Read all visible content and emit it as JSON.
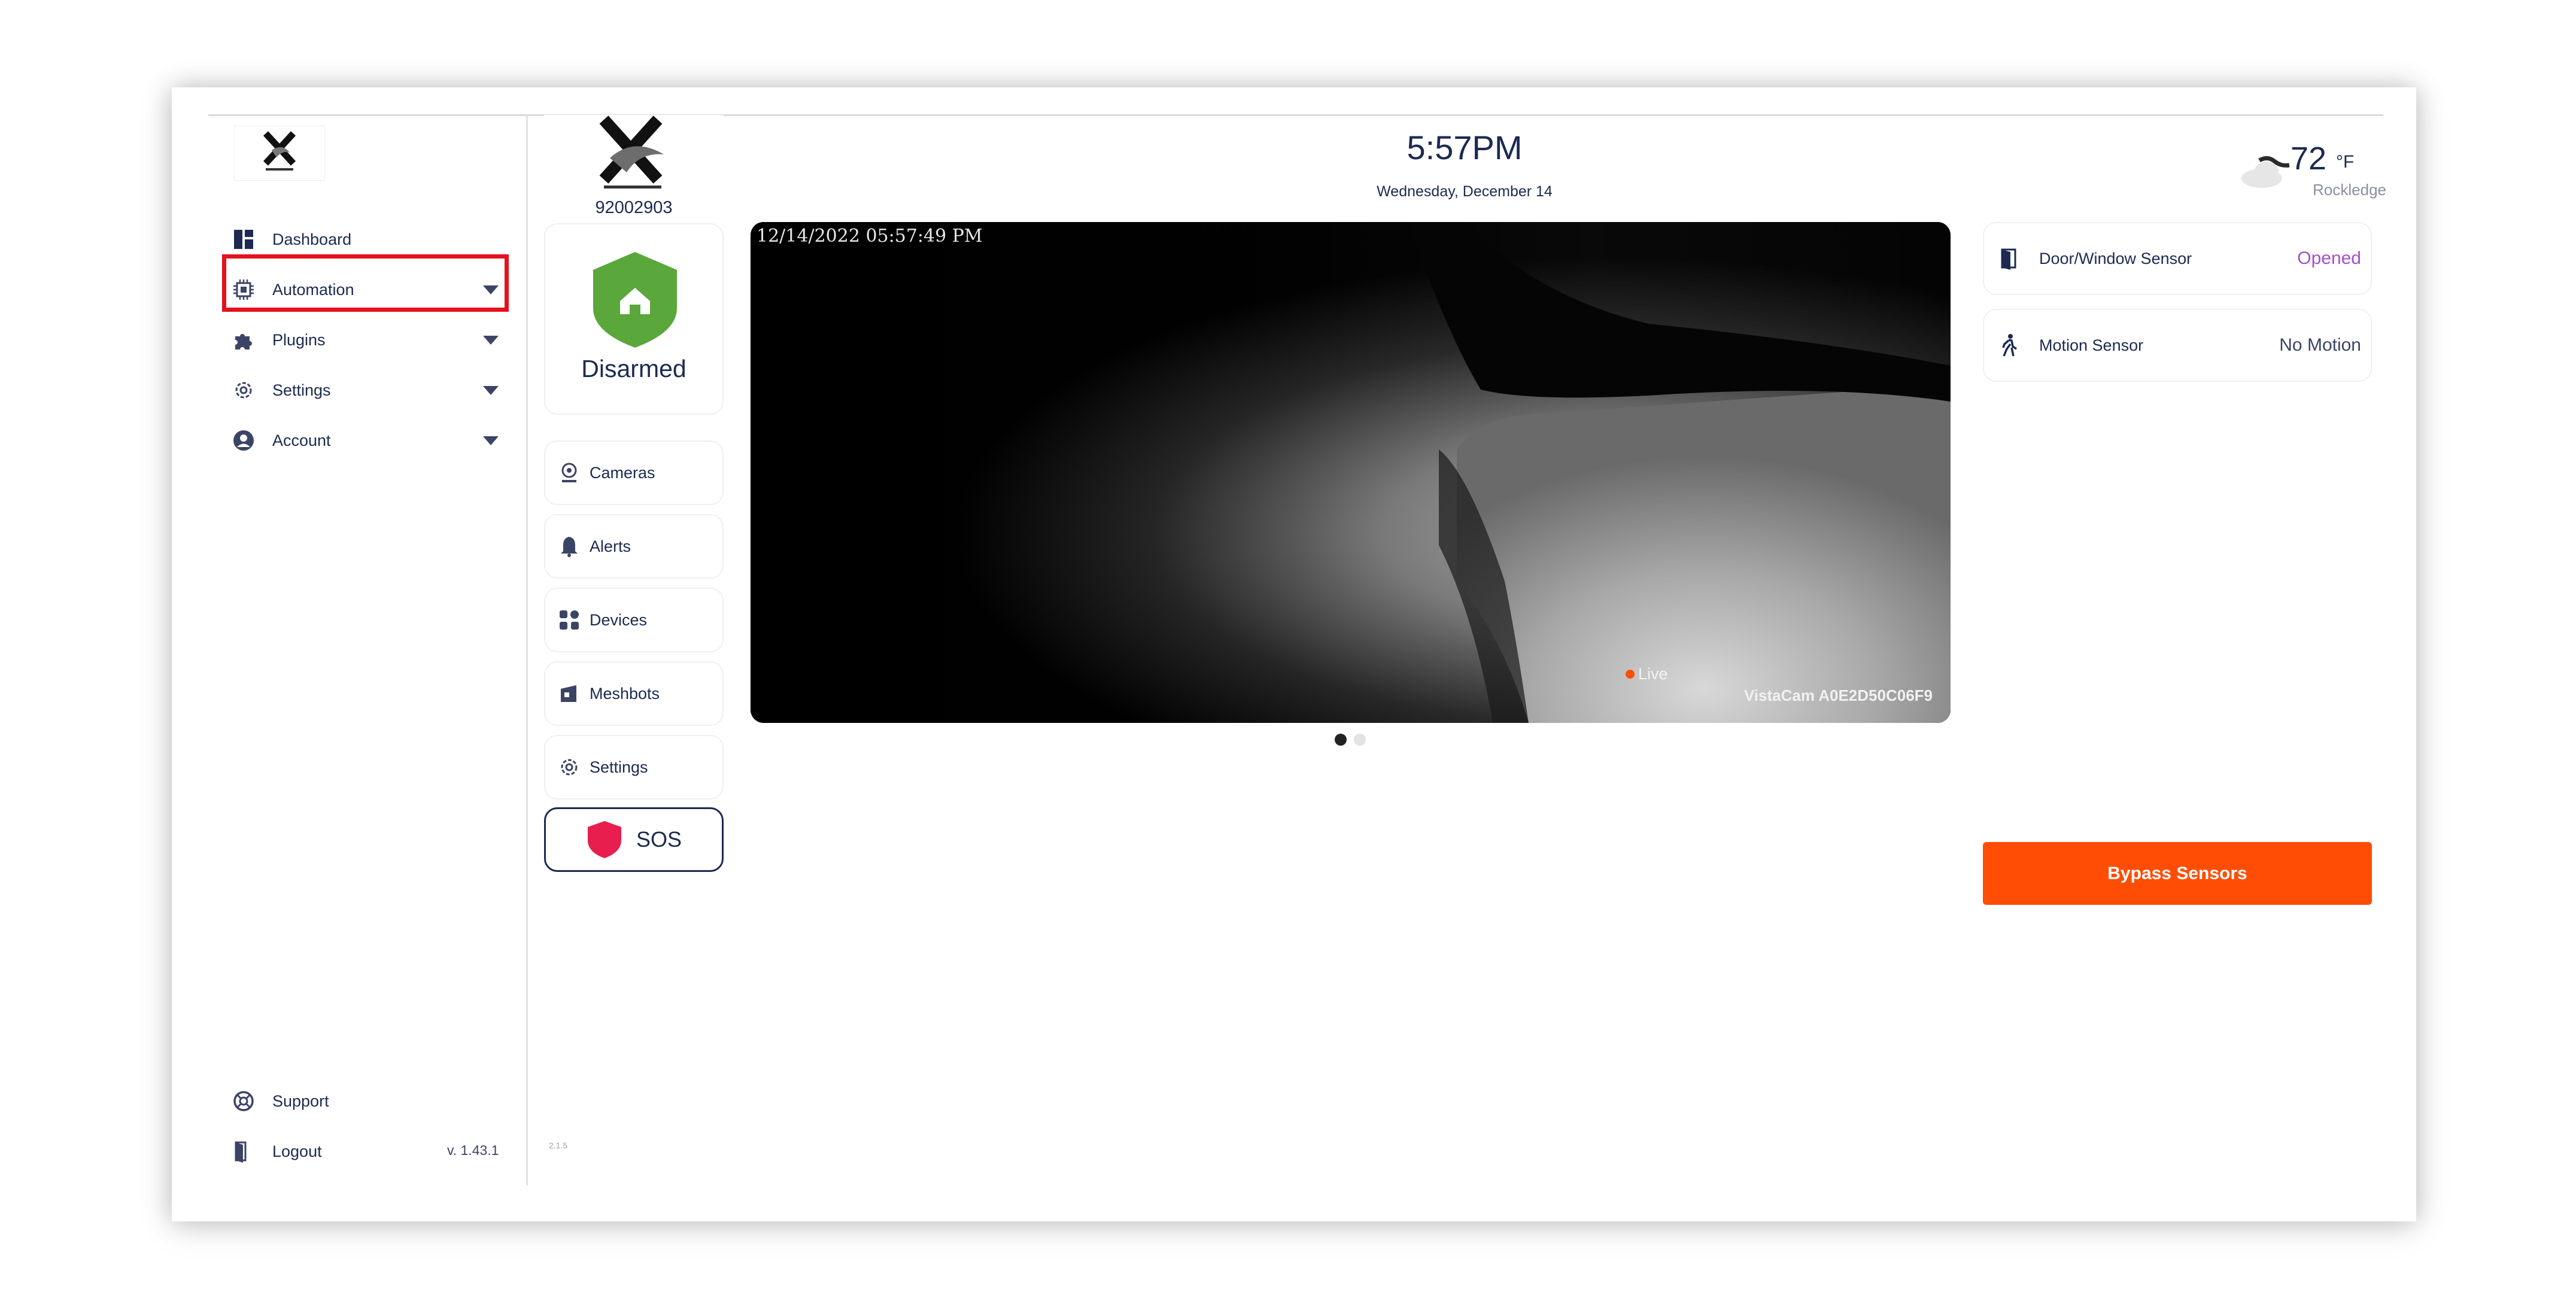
{
  "sidebar": {
    "logo_icon": "x-creative-logo",
    "items": [
      {
        "label": "Dashboard",
        "icon": "dashboard-icon"
      },
      {
        "label": "Automation",
        "icon": "automation-chip-icon",
        "highlighted": true
      },
      {
        "label": "Plugins",
        "icon": "puzzle-icon"
      },
      {
        "label": "Settings",
        "icon": "gear-icon"
      },
      {
        "label": "Account",
        "icon": "account-circle-icon"
      }
    ],
    "footer": [
      {
        "label": "Support",
        "icon": "lifebuoy-icon"
      },
      {
        "label": "Logout",
        "icon": "door-exit-icon"
      }
    ],
    "version": "v. 1.43.1"
  },
  "panel": {
    "account_number": "92002903",
    "security_status": "Disarmed",
    "status_color": "#5aa73c",
    "menu": [
      {
        "label": "Cameras",
        "icon": "camera-icon"
      },
      {
        "label": "Alerts",
        "icon": "bell-icon"
      },
      {
        "label": "Devices",
        "icon": "devices-grid-icon"
      },
      {
        "label": "Meshbots",
        "icon": "meshbot-icon"
      },
      {
        "label": "Settings",
        "icon": "gear-icon"
      }
    ],
    "sos_label": "SOS",
    "sos_color": "#e81e4e",
    "build": "2.1.5"
  },
  "header": {
    "time": "5:57PM",
    "date": "Wednesday, December 14"
  },
  "weather": {
    "icon": "cloud-wind-icon",
    "temperature": "72",
    "unit": "°F",
    "location": "Rockledge"
  },
  "camera": {
    "timestamp": "12/14/2022 05:57:49 PM",
    "live_label": "Live",
    "name": "VistaCam A0E2D50C06F9",
    "pages": 2,
    "active_page": 1
  },
  "sensors": [
    {
      "name": "Door/Window Sensor",
      "status": "Opened",
      "status_color": "#a64fc9",
      "icon": "door-icon"
    },
    {
      "name": "Motion Sensor",
      "status": "No Motion",
      "status_color": "#3c4466",
      "icon": "walking-person-icon"
    }
  ],
  "actions": {
    "bypass_label": "Bypass Sensors",
    "bypass_color": "#ff4d05"
  }
}
